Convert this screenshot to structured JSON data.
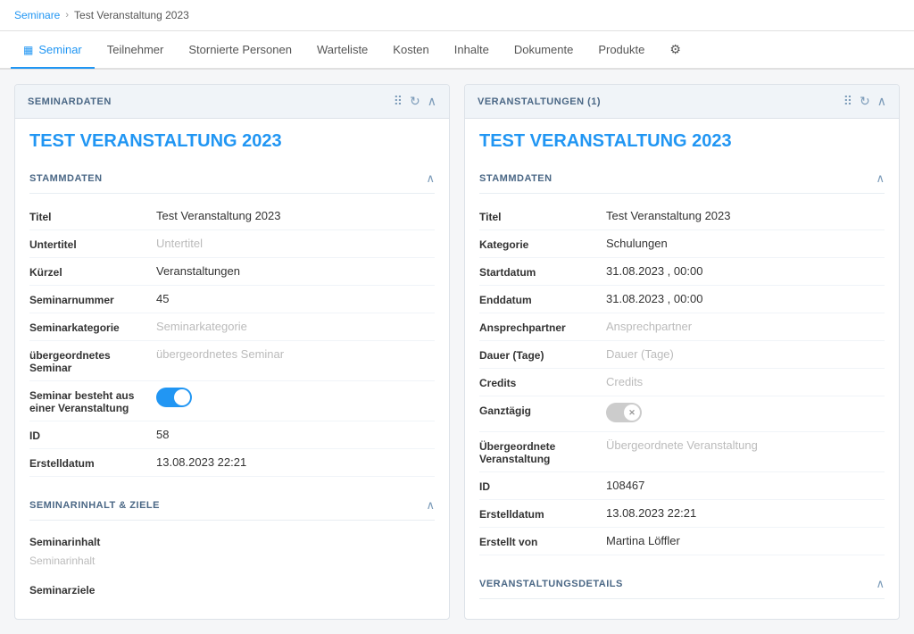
{
  "breadcrumb": {
    "link_label": "Seminare",
    "separator": "›",
    "current": "Test Veranstaltung 2023"
  },
  "tabs": [
    {
      "id": "seminar",
      "label": "Seminar",
      "icon": "▦",
      "active": true
    },
    {
      "id": "teilnehmer",
      "label": "Teilnehmer",
      "active": false
    },
    {
      "id": "stornierte",
      "label": "Stornierte Personen",
      "active": false
    },
    {
      "id": "warteliste",
      "label": "Warteliste",
      "active": false
    },
    {
      "id": "kosten",
      "label": "Kosten",
      "active": false
    },
    {
      "id": "inhalte",
      "label": "Inhalte",
      "active": false
    },
    {
      "id": "dokumente",
      "label": "Dokumente",
      "active": false
    },
    {
      "id": "produkte",
      "label": "Produkte",
      "active": false
    }
  ],
  "left_panel": {
    "header": "SEMINARDATEN",
    "main_title": "TEST VERANSTALTUNG 2023",
    "stammdaten": {
      "label": "STAMMDATEN",
      "fields": [
        {
          "label": "Titel",
          "value": "Test Veranstaltung 2023",
          "placeholder": false
        },
        {
          "label": "Untertitel",
          "value": "Untertitel",
          "placeholder": true
        },
        {
          "label": "Kürzel",
          "value": "Veranstaltungen",
          "placeholder": false
        },
        {
          "label": "Seminarnummer",
          "value": "45",
          "placeholder": false
        },
        {
          "label": "Seminarkategorie",
          "value": "Seminarkategorie",
          "placeholder": true
        },
        {
          "label": "übergeordnetes Seminar",
          "value": "übergeordnetes Seminar",
          "placeholder": true
        },
        {
          "label": "Seminar besteht aus einer Veranstaltung",
          "value": "toggle_on",
          "placeholder": false
        },
        {
          "label": "ID",
          "value": "58",
          "placeholder": false
        },
        {
          "label": "Erstelldatum",
          "value": "13.08.2023 22:21",
          "placeholder": false
        }
      ]
    },
    "seminarinhalt": {
      "label": "SEMINARINHALT & ZIELE",
      "fields": [
        {
          "label": "Seminarinhalt",
          "value": "Seminarinhalt",
          "placeholder": true
        },
        {
          "label": "Seminarziele",
          "value": "",
          "placeholder": false
        }
      ]
    }
  },
  "right_panel": {
    "header": "VERANSTALTUNGEN (1)",
    "main_title": "TEST VERANSTALTUNG 2023",
    "stammdaten": {
      "label": "STAMMDATEN",
      "fields": [
        {
          "label": "Titel",
          "value": "Test Veranstaltung 2023",
          "placeholder": false
        },
        {
          "label": "Kategorie",
          "value": "Schulungen",
          "placeholder": false
        },
        {
          "label": "Startdatum",
          "value": "31.08.2023 ,  00:00",
          "placeholder": false
        },
        {
          "label": "Enddatum",
          "value": "31.08.2023 ,  00:00",
          "placeholder": false
        },
        {
          "label": "Ansprechpartner",
          "value": "Ansprechpartner",
          "placeholder": true
        },
        {
          "label": "Dauer (Tage)",
          "value": "Dauer (Tage)",
          "placeholder": true
        },
        {
          "label": "Credits",
          "value": "Credits",
          "placeholder": true
        },
        {
          "label": "Ganztägig",
          "value": "toggle_off_x",
          "placeholder": false
        },
        {
          "label": "Übergeordnete Veranstaltung",
          "value": "Übergeordnete Veranstaltung",
          "placeholder": true
        },
        {
          "label": "ID",
          "value": "108467",
          "placeholder": false
        },
        {
          "label": "Erstelldatum",
          "value": "13.08.2023 22:21",
          "placeholder": false
        },
        {
          "label": "Erstellt von",
          "value": "Martina Löffler",
          "placeholder": false
        }
      ]
    },
    "veranstaltungsdetails": {
      "label": "VERANSTALTUNGSDETAILS"
    }
  },
  "icons": {
    "grid": "⠿",
    "refresh": "↻",
    "collapse": "∧",
    "gear": "⚙"
  }
}
